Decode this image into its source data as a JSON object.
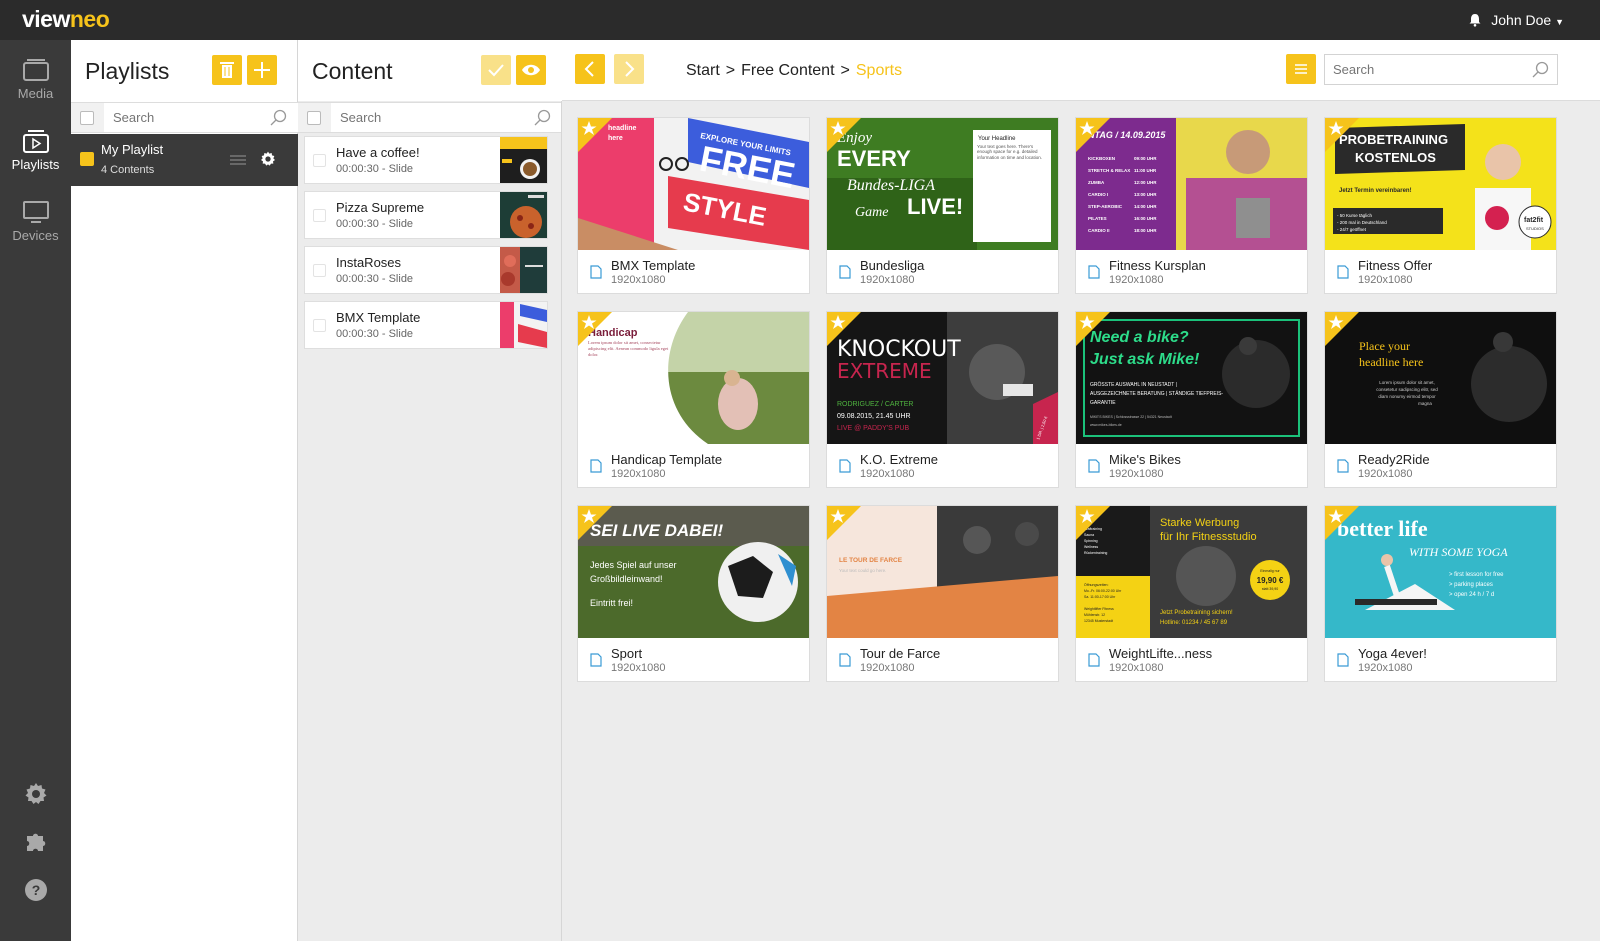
{
  "app": {
    "logo_part1": "view",
    "logo_part2": "neo",
    "user_name": "John Doe",
    "accent": "#f6c31b"
  },
  "rail": {
    "items": [
      {
        "label": "Media",
        "icon": "media-icon"
      },
      {
        "label": "Playlists",
        "icon": "playlist-icon"
      },
      {
        "label": "Devices",
        "icon": "monitor-icon"
      }
    ],
    "bottom_icons": [
      "gear-icon",
      "puzzle-icon",
      "help-icon"
    ]
  },
  "playlists": {
    "title": "Playlists",
    "search_placeholder": "Search",
    "items": [
      {
        "name": "My Playlist",
        "count": "4 Contents"
      }
    ]
  },
  "content": {
    "title": "Content",
    "search_placeholder": "Search",
    "items": [
      {
        "title": "Have a coffee!",
        "sub": "00:00:30 - Slide"
      },
      {
        "title": "Pizza Supreme",
        "sub": "00:00:30 - Slide"
      },
      {
        "title": "InstaRoses",
        "sub": "00:00:30 - Slide"
      },
      {
        "title": "BMX Template",
        "sub": "00:00:30 - Slide"
      }
    ]
  },
  "main": {
    "breadcrumb": {
      "start": "Start",
      "sep1": ">",
      "mid": "Free Content",
      "sep2": ">",
      "current": "Sports"
    },
    "search_placeholder": "Search",
    "cards": [
      {
        "name": "BMX Template",
        "res": "1920x1080"
      },
      {
        "name": "Bundesliga",
        "res": "1920x1080"
      },
      {
        "name": "Fitness Kursplan",
        "res": "1920x1080"
      },
      {
        "name": "Fitness Offer",
        "res": "1920x1080"
      },
      {
        "name": "Handicap Template",
        "res": "1920x1080"
      },
      {
        "name": "K.O. Extreme",
        "res": "1920x1080"
      },
      {
        "name": "Mike's Bikes",
        "res": "1920x1080"
      },
      {
        "name": "Ready2Ride",
        "res": "1920x1080"
      },
      {
        "name": "Sport",
        "res": "1920x1080"
      },
      {
        "name": "Tour de Farce",
        "res": "1920x1080"
      },
      {
        "name": "WeightLifte...ness",
        "res": "1920x1080"
      },
      {
        "name": "Yoga 4ever!",
        "res": "1920x1080"
      }
    ],
    "thumbs": {
      "bmx": [
        "headline",
        "here",
        "EXPLORE YOUR LIMITS",
        "FREE",
        "STYLE"
      ],
      "bundesliga": [
        "Enjoy",
        "EVERY",
        "Bundes-LIGA",
        "Game",
        "LIVE!",
        "Your Headline",
        "Your text goes here. There's enough space for e.g. detailed information on time and location."
      ],
      "kursplan": [
        "NTAG / 14.09.2015",
        "KICKBOXEN",
        "STRETCH & RELAX",
        "ZUMBA",
        "CARDIO I",
        "STEP-AEROBIC",
        "PILATES",
        "CARDIO II",
        "09:00 UHR",
        "11:00 UHR",
        "12:00 UHR",
        "13:00 UHR",
        "14:00 UHR",
        "16:00 UHR",
        "18:00 UHR"
      ],
      "offer": [
        "PROBETRAINING",
        "KOSTENLOS",
        "Jetzt Termin vereinbaren!",
        "- 50 Kurse täglich",
        "- 200 mal in Deutschland",
        "- 24/7 geöffnet",
        "fat2fit",
        "STUDIOS"
      ],
      "handicap": [
        "Handicap",
        "Lorem ipsum dolor sit amet, consectetur adipiscing elit. Aenean commodo ligula eget dolor."
      ],
      "knockout": [
        "KNOCKOUT",
        "EXTREME",
        "RODRIGUEZ / CARTER",
        "09.08.2015, 21.45 UHR",
        "LIVE @ PADDY'S PUB",
        "1 DR. | 2,50 €"
      ],
      "mikes": [
        "Need a bike?",
        "Just ask Mike!",
        "GRÖSSTE AUSWAHL IN NEUSTADT |",
        "AUSGEZEICHNETE BERATUNG | STÄNDIGE TIEFPREIS-",
        "GARANTIE",
        "MIKE'S BIKES | Schlossstrasse 22 | 54321 Neustadt",
        "www.mikes-bikes.de"
      ],
      "ready": [
        "Place your",
        "headline here",
        "Lorem ipsum dolor sit amet,",
        "consetetur sadipscing elitr, sed",
        "diam nonumy eirmod tempor",
        "magna"
      ],
      "sport": [
        "SEI LIVE DABEI!",
        "Jedes Spiel auf unser",
        "Großbildleinwand!",
        "Eintritt frei!"
      ],
      "tour": [
        "LE TOUR DE FARCE",
        "Your text could go here."
      ],
      "weight": [
        "Starke Werbung",
        "für Ihr Fitnessstudio",
        "Kraftraining",
        "Sauna",
        "Spinning",
        "Wellness",
        "Rückentraining",
        "Öffnungszeiten:",
        "Mo.-Fr. 06:00-22:00 Uhr",
        "Sa. 11:00-17:00 Uhr",
        "Weightlifter Fitness",
        "Mühlenstr. 12",
        "12345 Musterstadt",
        "Jetzt Probetraining sichern!",
        "Hotline: 01234 / 45 67 89",
        "Einmalig nur",
        "19,90 €",
        "statt 39,90"
      ],
      "yoga": [
        "better life",
        "WITH SOME YOGA",
        "> first lesson for free",
        "> parking places",
        "> open 24 h / 7 d"
      ]
    }
  }
}
